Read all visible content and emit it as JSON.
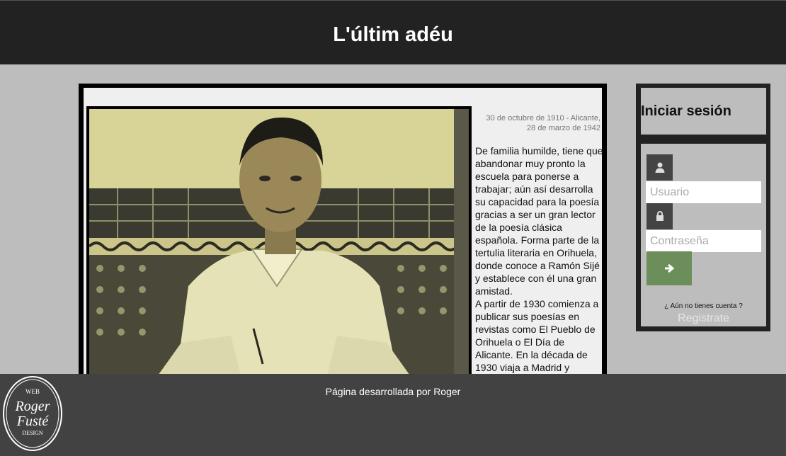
{
  "header": {
    "title": "L'últim adéu"
  },
  "article": {
    "meta": "30 de octubre de 1910 - Alicante, 28 de marzo de 1942",
    "bio_p1": "De familia humilde, tiene que abandonar muy pronto la escuela para ponerse a trabajar; aún así desarrolla su capacidad para la poesía gracias a ser un gran lector de la poesía clásica española. Forma parte de la tertulia literaria en Orihuela, donde conoce a Ramón Sijé y establece con él una gran amistad.",
    "bio_p2": "A partir de 1930 comienza a publicar sus poesías en revistas como El Pueblo de Orihuela o El Día de Alicante. En la década de 1930 viaja a Madrid y colabora en distintas"
  },
  "login": {
    "title": "Iniciar sesión",
    "user_placeholder": "Usuario",
    "password_placeholder": "Contraseña",
    "no_account": "¿ Aún no tienes cuenta ?",
    "register_link": "Registrate"
  },
  "footer": {
    "text": "Página desarrollada por Roger",
    "logo": {
      "top": "WEB",
      "line1": "Roger",
      "line2": "Fusté",
      "bottom": "DESIGN"
    }
  },
  "icons": {
    "user": "user-icon",
    "lock": "lock-icon",
    "submit": "arrow-right-icon"
  },
  "colors": {
    "header_bg": "#222222",
    "page_bg": "#bdbdbd",
    "footer_bg": "#424242",
    "submit_bg": "#6b8e5a"
  }
}
